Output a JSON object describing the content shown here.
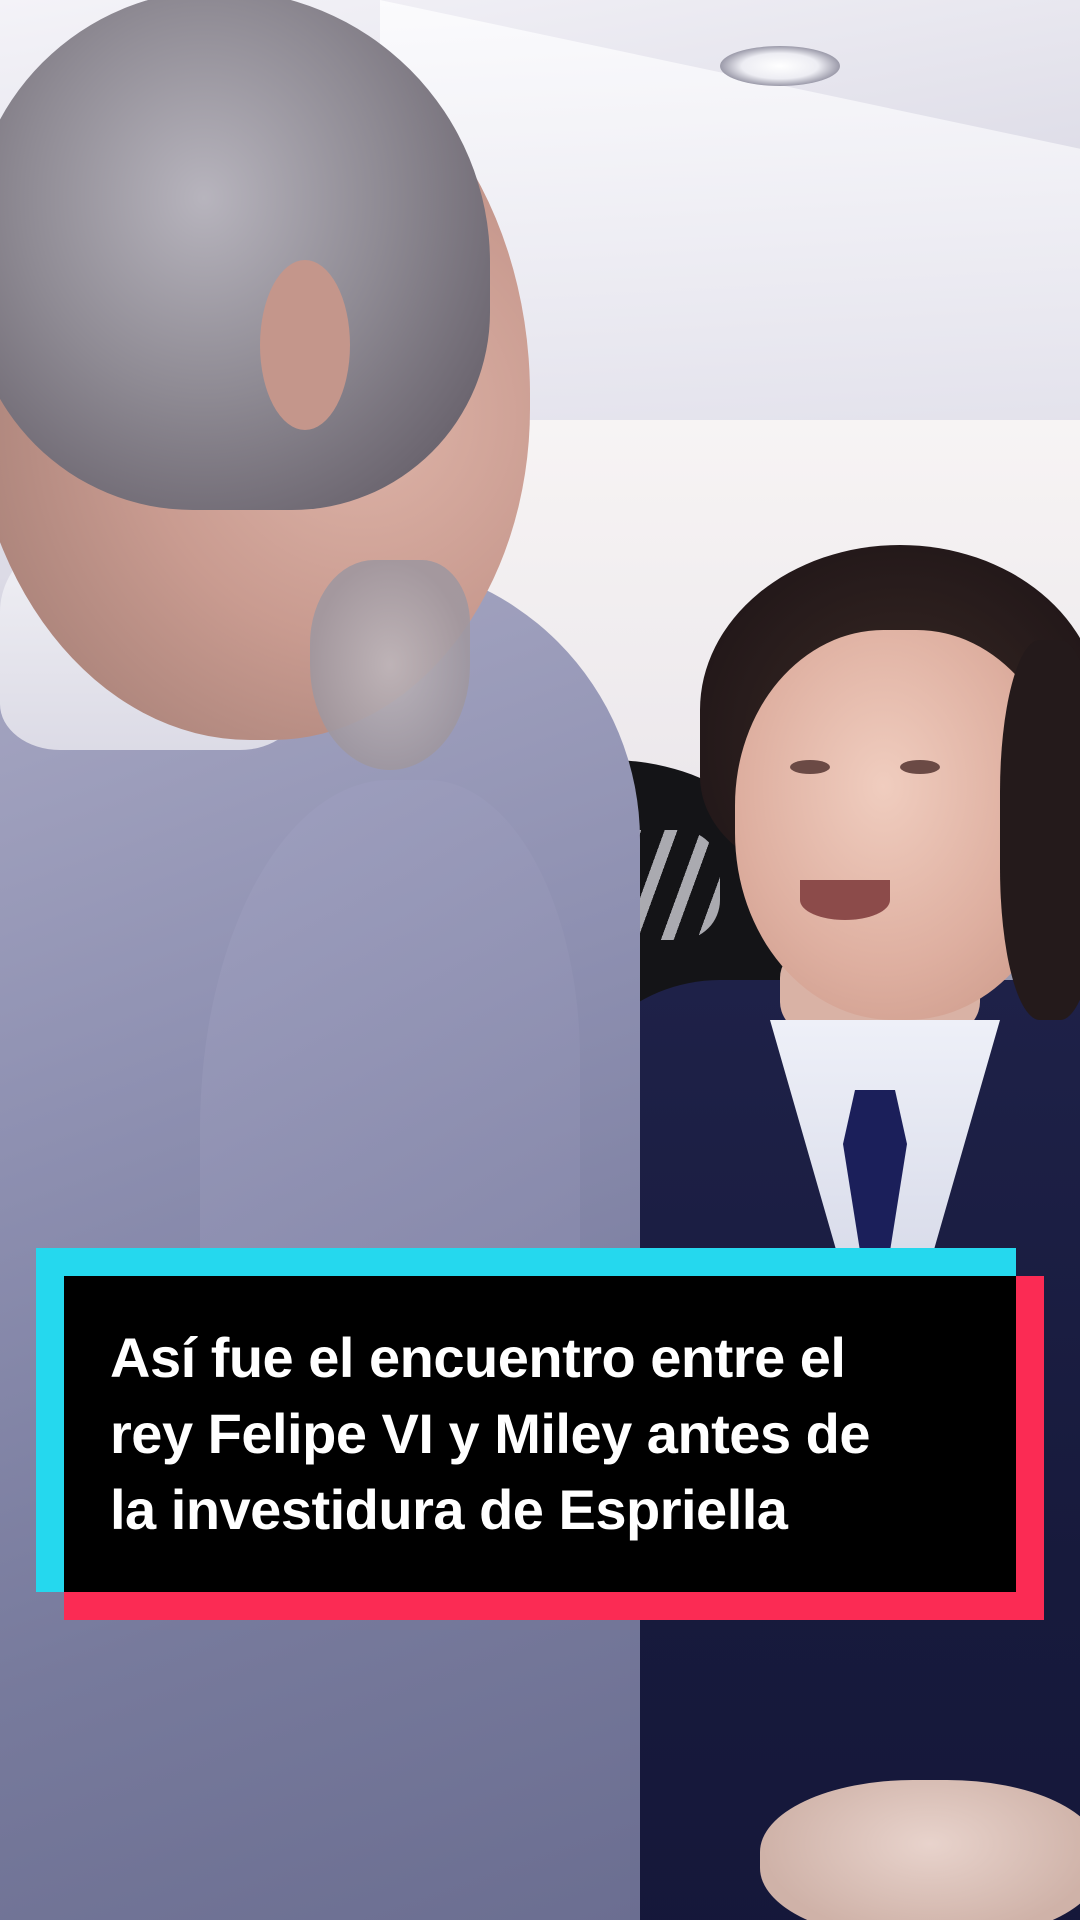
{
  "caption": {
    "lines": [
      "Así fue el encuentro entre el",
      "rey Felipe VI y Miley antes de",
      "la investidura de Espriella"
    ],
    "colors": {
      "box": "#000000",
      "text": "#ffffff",
      "accent_cyan": "#25d8ee",
      "accent_red": "#fb2b54"
    }
  }
}
